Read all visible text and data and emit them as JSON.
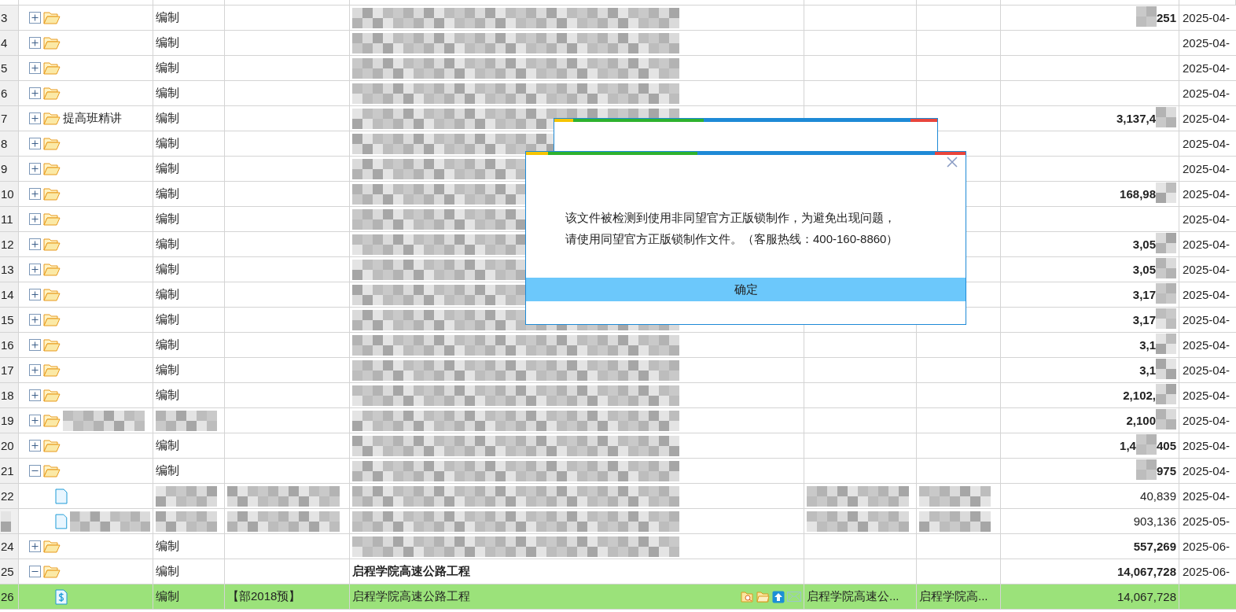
{
  "table": {
    "rows": [
      {
        "number": "3",
        "kind": "folder",
        "expanded": false,
        "status": "编制",
        "name": {
          "kind": "mask"
        },
        "amount": [
          {
            "kind": "mask"
          },
          {
            "kind": "text",
            "text": "251"
          }
        ],
        "date": "2025-04-",
        "selected": false
      },
      {
        "number": "4",
        "kind": "folder",
        "expanded": false,
        "status": "编制",
        "name": {
          "kind": "mask"
        },
        "amount": [],
        "date": "2025-04-",
        "selected": false
      },
      {
        "number": "5",
        "kind": "folder",
        "expanded": false,
        "status": "编制",
        "name": {
          "kind": "mask"
        },
        "amount": [],
        "date": "2025-04-",
        "selected": false
      },
      {
        "number": "6",
        "kind": "folder",
        "expanded": false,
        "status": "编制",
        "name": {
          "kind": "mask"
        },
        "amount": [],
        "date": "2025-04-",
        "selected": false
      },
      {
        "number": "7",
        "kind": "folder",
        "expanded": false,
        "label": "提高班精讲",
        "status": "编制",
        "name": {
          "kind": "mask"
        },
        "amount": [
          {
            "kind": "text",
            "text": "3,137,4"
          },
          {
            "kind": "mask"
          }
        ],
        "date": "2025-04-",
        "selected": false
      },
      {
        "number": "8",
        "kind": "folder",
        "expanded": false,
        "status": "编制",
        "name": {
          "kind": "mask"
        },
        "amount": [],
        "date": "2025-04-",
        "selected": false
      },
      {
        "number": "9",
        "kind": "folder",
        "expanded": false,
        "status": "编制",
        "name": {
          "kind": "mask"
        },
        "amount": [],
        "date": "2025-04-",
        "selected": false
      },
      {
        "number": "10",
        "kind": "folder",
        "expanded": false,
        "status": "编制",
        "name": {
          "kind": "mask"
        },
        "amount": [
          {
            "kind": "text",
            "text": "168,98"
          },
          {
            "kind": "mask"
          }
        ],
        "date": "2025-04-",
        "selected": false
      },
      {
        "number": "11",
        "kind": "folder",
        "expanded": false,
        "status": "编制",
        "name": {
          "kind": "mask"
        },
        "amount": [],
        "date": "2025-04-",
        "selected": false
      },
      {
        "number": "12",
        "kind": "folder",
        "expanded": false,
        "status": "编制",
        "name": {
          "kind": "mask"
        },
        "amount": [
          {
            "kind": "text",
            "text": "3,05"
          },
          {
            "kind": "mask"
          }
        ],
        "date": "2025-04-",
        "selected": false
      },
      {
        "number": "13",
        "kind": "folder",
        "expanded": false,
        "status": "编制",
        "name": {
          "kind": "mask"
        },
        "amount": [
          {
            "kind": "text",
            "text": "3,05"
          },
          {
            "kind": "mask"
          }
        ],
        "date": "2025-04-",
        "selected": false
      },
      {
        "number": "14",
        "kind": "folder",
        "expanded": false,
        "status": "编制",
        "name": {
          "kind": "mask"
        },
        "amount": [
          {
            "kind": "text",
            "text": "3,17"
          },
          {
            "kind": "mask"
          }
        ],
        "date": "2025-04-",
        "selected": false
      },
      {
        "number": "15",
        "kind": "folder",
        "expanded": false,
        "status": "编制",
        "name": {
          "kind": "mask"
        },
        "amount": [
          {
            "kind": "text",
            "text": "3,17"
          },
          {
            "kind": "mask"
          }
        ],
        "date": "2025-04-",
        "selected": false
      },
      {
        "number": "16",
        "kind": "folder",
        "expanded": false,
        "status": "编制",
        "name": {
          "kind": "mask"
        },
        "amount": [
          {
            "kind": "text",
            "text": "3,1"
          },
          {
            "kind": "mask"
          }
        ],
        "date": "2025-04-",
        "selected": false
      },
      {
        "number": "17",
        "kind": "folder",
        "expanded": false,
        "status": "编制",
        "name": {
          "kind": "mask"
        },
        "amount": [
          {
            "kind": "text",
            "text": "3,1"
          },
          {
            "kind": "mask"
          }
        ],
        "date": "2025-04-",
        "selected": false
      },
      {
        "number": "18",
        "kind": "folder",
        "expanded": false,
        "status": "编制",
        "name": {
          "kind": "mask"
        },
        "amount": [
          {
            "kind": "text",
            "text": "2,102,"
          },
          {
            "kind": "mask"
          }
        ],
        "date": "2025-04-",
        "selected": false
      },
      {
        "number": "19",
        "kind": "folder",
        "expanded": false,
        "label": {
          "kind": "mask"
        },
        "status": {
          "kind": "mask"
        },
        "name": {
          "kind": "mask"
        },
        "amount": [
          {
            "kind": "text",
            "text": "2,100"
          },
          {
            "kind": "mask"
          }
        ],
        "date": "2025-04-",
        "selected": false
      },
      {
        "number": "20",
        "kind": "folder",
        "expanded": false,
        "status": "编制",
        "name": {
          "kind": "mask"
        },
        "amount": [
          {
            "kind": "text",
            "text": "1,4"
          },
          {
            "kind": "mask"
          },
          {
            "kind": "text",
            "text": "405"
          }
        ],
        "date": "2025-04-",
        "selected": false
      },
      {
        "number": "21",
        "kind": "folder",
        "expanded": true,
        "status": "编制",
        "name": {
          "kind": "mask"
        },
        "amount": [
          {
            "kind": "mask"
          },
          {
            "kind": "text",
            "text": "975"
          }
        ],
        "date": "2025-04-",
        "selected": false
      },
      {
        "number": "22",
        "kind": "file",
        "status": {
          "kind": "mask"
        },
        "code": {
          "kind": "mask"
        },
        "name": {
          "kind": "mask"
        },
        "col_6": {
          "kind": "mask"
        },
        "col_7": {
          "kind": "mask"
        },
        "amount": [
          {
            "kind": "text",
            "text": "40,839"
          }
        ],
        "date": "2025-04-",
        "selected": false
      },
      {
        "number": {
          "kind": "mask"
        },
        "kind": "file",
        "label": {
          "kind": "mask"
        },
        "status": {
          "kind": "mask"
        },
        "code": {
          "kind": "mask"
        },
        "name": {
          "kind": "mask"
        },
        "col_6": {
          "kind": "mask"
        },
        "col_7": {
          "kind": "mask"
        },
        "amount": [
          {
            "kind": "text",
            "text": "903,136"
          }
        ],
        "date": "2025-05-",
        "selected": false
      },
      {
        "number": "24",
        "kind": "folder",
        "expanded": false,
        "status": "编制",
        "name": {
          "kind": "mask"
        },
        "amount": [
          {
            "kind": "text",
            "text": "557,269"
          }
        ],
        "date": "2025-06-",
        "selected": false
      },
      {
        "number": "25",
        "kind": "folder",
        "expanded": true,
        "status": "编制",
        "name": "启程学院高速公路工程",
        "amount": [
          {
            "kind": "text",
            "text": "14,067,728"
          }
        ],
        "date": "2025-06-",
        "selected": false
      },
      {
        "number": "26",
        "kind": "bill",
        "status": "编制",
        "code": "【部2018预】",
        "name": "启程学院高速公路工程",
        "tools": true,
        "col_6": "启程学院高速公...",
        "col_7": "启程学院高...",
        "amount": [
          {
            "kind": "text",
            "text": "14,067,728"
          }
        ],
        "selected": true
      }
    ]
  },
  "dialog": {
    "message": [
      "该文件被检测到使用非同望官方正版锁制作，为避免出现问题，",
      "请使用同望官方正版锁制作文件。（客服热线：400-160-8860）"
    ],
    "button": "确定"
  }
}
